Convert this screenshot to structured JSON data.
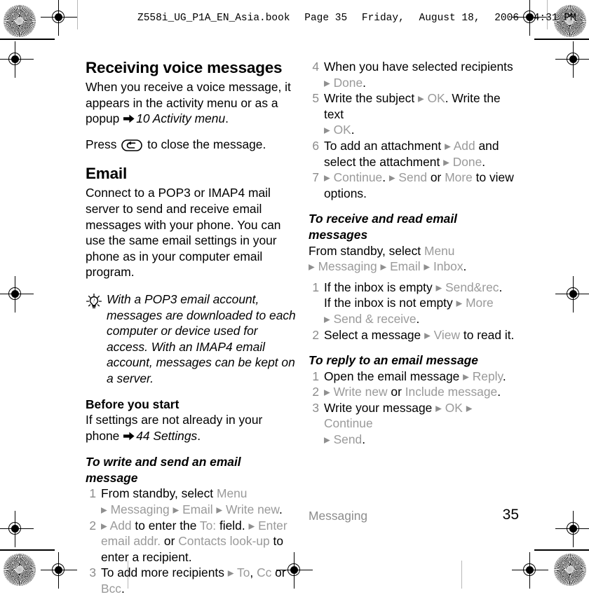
{
  "header": {
    "filename": "Z558i_UG_P1A_EN_Asia.book",
    "page_label": "Page 35",
    "weekday": "Friday,",
    "month_day": "August 18,",
    "year": "2006",
    "time": "4:31 PM"
  },
  "left_column": {
    "heading_voice": "Receiving voice messages",
    "voice_p1_a": "When you receive a voice message, it appears in the activity menu or as a popup ",
    "voice_p1_xref": "10 Activity menu",
    "voice_p1_end": ".",
    "voice_p2_a": "Press ",
    "voice_p2_b": " to close the message.",
    "heading_email": "Email",
    "email_p1": "Connect to a POP3 or IMAP4 mail server to send and receive email messages with your phone. You can use the same email settings in your phone as in your computer email program.",
    "tip_text": "With a POP3 email account, messages are downloaded to each computer or device used for access. With an IMAP4 email account, messages can be kept on a server.",
    "heading_before": "Before you start",
    "before_a": "If settings are not already in your phone ",
    "before_xref": "44 Settings",
    "before_end": ".",
    "heading_write": "To write and send an email message",
    "steps": [
      {
        "num": "1",
        "parts": [
          {
            "t": "From standby, select ",
            "s": "plain"
          },
          {
            "t": "Menu",
            "s": "cmd"
          },
          {
            "t": "\n",
            "s": "br"
          },
          {
            "t": "▸ ",
            "s": "arrow"
          },
          {
            "t": "Messaging",
            "s": "cmd"
          },
          {
            "t": " ▸ ",
            "s": "arrow"
          },
          {
            "t": "Email",
            "s": "cmd"
          },
          {
            "t": " ▸ ",
            "s": "arrow"
          },
          {
            "t": "Write new",
            "s": "cmd"
          },
          {
            "t": ".",
            "s": "plain"
          }
        ]
      },
      {
        "num": "2",
        "parts": [
          {
            "t": "▸ ",
            "s": "arrow"
          },
          {
            "t": "Add",
            "s": "cmd"
          },
          {
            "t": " to enter the ",
            "s": "plain"
          },
          {
            "t": "To:",
            "s": "cmd"
          },
          {
            "t": " field. ",
            "s": "plain"
          },
          {
            "t": "▸ ",
            "s": "arrow"
          },
          {
            "t": "Enter email addr.",
            "s": "cmd"
          },
          {
            "t": " or ",
            "s": "plain"
          },
          {
            "t": "Contacts look-up",
            "s": "cmd"
          },
          {
            "t": " to enter a recipient.",
            "s": "plain"
          }
        ]
      },
      {
        "num": "3",
        "parts": [
          {
            "t": "To add more recipients ",
            "s": "plain"
          },
          {
            "t": "▸ ",
            "s": "arrow"
          },
          {
            "t": "To",
            "s": "cmd"
          },
          {
            "t": ", ",
            "s": "plain"
          },
          {
            "t": "Cc",
            "s": "cmd"
          },
          {
            "t": " or ",
            "s": "plain"
          },
          {
            "t": "Bcc",
            "s": "cmd"
          },
          {
            "t": ".",
            "s": "plain"
          }
        ]
      }
    ]
  },
  "right_column": {
    "steps_continued": [
      {
        "num": "4",
        "parts": [
          {
            "t": "When you have selected recipients",
            "s": "plain"
          },
          {
            "t": "\n",
            "s": "br"
          },
          {
            "t": "▸ ",
            "s": "arrow"
          },
          {
            "t": "Done",
            "s": "cmd"
          },
          {
            "t": ".",
            "s": "plain"
          }
        ]
      },
      {
        "num": "5",
        "parts": [
          {
            "t": "Write the subject ",
            "s": "plain"
          },
          {
            "t": "▸ ",
            "s": "arrow"
          },
          {
            "t": "OK",
            "s": "cmd"
          },
          {
            "t": ". Write the text",
            "s": "plain"
          },
          {
            "t": "\n",
            "s": "br"
          },
          {
            "t": "▸ ",
            "s": "arrow"
          },
          {
            "t": "OK",
            "s": "cmd"
          },
          {
            "t": ".",
            "s": "plain"
          }
        ]
      },
      {
        "num": "6",
        "parts": [
          {
            "t": "To add an attachment ",
            "s": "plain"
          },
          {
            "t": "▸ ",
            "s": "arrow"
          },
          {
            "t": "Add",
            "s": "cmd"
          },
          {
            "t": " and select the attachment ",
            "s": "plain"
          },
          {
            "t": "▸ ",
            "s": "arrow"
          },
          {
            "t": "Done",
            "s": "cmd"
          },
          {
            "t": ".",
            "s": "plain"
          }
        ]
      },
      {
        "num": "7",
        "parts": [
          {
            "t": "▸ ",
            "s": "arrow"
          },
          {
            "t": "Continue",
            "s": "cmd"
          },
          {
            "t": ". ",
            "s": "plain"
          },
          {
            "t": "▸ ",
            "s": "arrow"
          },
          {
            "t": "Send",
            "s": "cmd"
          },
          {
            "t": " or ",
            "s": "plain"
          },
          {
            "t": "More",
            "s": "cmd"
          },
          {
            "t": " to view options.",
            "s": "plain"
          }
        ]
      }
    ],
    "heading_receive": "To receive and read email messages",
    "receive_intro": [
      {
        "t": "From standby, select ",
        "s": "plain"
      },
      {
        "t": "Menu",
        "s": "cmd"
      },
      {
        "t": "\n",
        "s": "br"
      },
      {
        "t": "▸ ",
        "s": "arrow"
      },
      {
        "t": "Messaging",
        "s": "cmd"
      },
      {
        "t": " ▸ ",
        "s": "arrow"
      },
      {
        "t": "Email",
        "s": "cmd"
      },
      {
        "t": " ▸ ",
        "s": "arrow"
      },
      {
        "t": "Inbox",
        "s": "cmd"
      },
      {
        "t": ".",
        "s": "plain"
      }
    ],
    "receive_steps": [
      {
        "num": "1",
        "parts": [
          {
            "t": "If the inbox is empty ",
            "s": "plain"
          },
          {
            "t": "▸ ",
            "s": "arrow"
          },
          {
            "t": "Send&rec",
            "s": "cmd"
          },
          {
            "t": ".",
            "s": "plain"
          },
          {
            "t": "\n",
            "s": "br"
          },
          {
            "t": "If the inbox is not empty ",
            "s": "plain"
          },
          {
            "t": "▸ ",
            "s": "arrow"
          },
          {
            "t": "More",
            "s": "cmd"
          },
          {
            "t": "\n",
            "s": "br"
          },
          {
            "t": "▸ ",
            "s": "arrow"
          },
          {
            "t": "Send & receive",
            "s": "cmd"
          },
          {
            "t": ".",
            "s": "plain"
          }
        ]
      },
      {
        "num": "2",
        "parts": [
          {
            "t": "Select a message ",
            "s": "plain"
          },
          {
            "t": "▸ ",
            "s": "arrow"
          },
          {
            "t": "View",
            "s": "cmd"
          },
          {
            "t": " to read it.",
            "s": "plain"
          }
        ]
      }
    ],
    "heading_reply": "To reply to an email message",
    "reply_steps": [
      {
        "num": "1",
        "parts": [
          {
            "t": "Open the email message ",
            "s": "plain"
          },
          {
            "t": "▸ ",
            "s": "arrow"
          },
          {
            "t": "Reply",
            "s": "cmd"
          },
          {
            "t": ".",
            "s": "plain"
          }
        ]
      },
      {
        "num": "2",
        "parts": [
          {
            "t": "▸ ",
            "s": "arrow"
          },
          {
            "t": "Write new",
            "s": "cmd"
          },
          {
            "t": " or ",
            "s": "plain"
          },
          {
            "t": "Include message",
            "s": "cmd"
          },
          {
            "t": ".",
            "s": "plain"
          }
        ]
      },
      {
        "num": "3",
        "parts": [
          {
            "t": "Write your message ",
            "s": "plain"
          },
          {
            "t": "▸ ",
            "s": "arrow"
          },
          {
            "t": "OK",
            "s": "cmd"
          },
          {
            "t": " ▸ ",
            "s": "arrow"
          },
          {
            "t": "Continue",
            "s": "cmd"
          },
          {
            "t": "\n",
            "s": "br"
          },
          {
            "t": "▸ ",
            "s": "arrow"
          },
          {
            "t": "Send",
            "s": "cmd"
          },
          {
            "t": ".",
            "s": "plain"
          }
        ]
      }
    ]
  },
  "footer": {
    "chapter": "Messaging",
    "page_number": "35"
  },
  "colors": {
    "command_gray": "#9a9a9a",
    "number_gray": "#8c8c8c",
    "text_black": "#000000"
  },
  "icons": {
    "tip": "lightbulb-icon",
    "back_key": "back-key-icon",
    "cross_reference": "right-arrow-icon",
    "menu_step": "small-right-triangle-icon"
  }
}
